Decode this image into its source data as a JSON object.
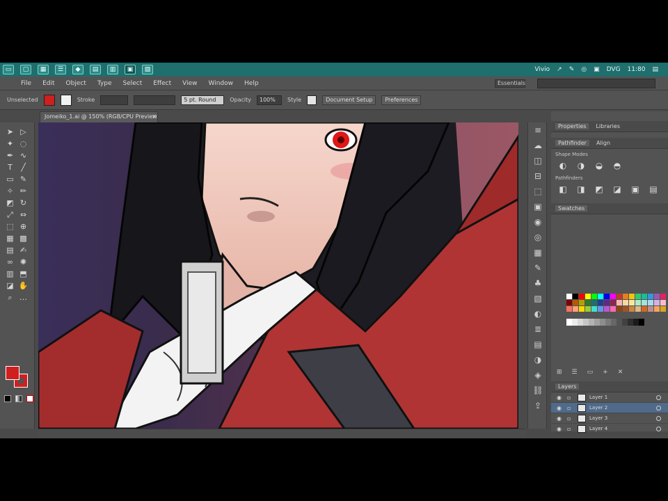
{
  "taskbar": {
    "icons": [
      "window-icon",
      "desktop-icon",
      "file-explorer-icon",
      "list-icon",
      "diamond-app-icon",
      "spreadsheet-icon",
      "chart-app-icon",
      "illustrator-icon",
      "image-app-icon"
    ],
    "tray": {
      "label_1": "Vivio",
      "label_2": "DVG",
      "clock": "11:80"
    }
  },
  "menubar": {
    "items": [
      "File",
      "Edit",
      "Object",
      "Type",
      "Select",
      "Effect",
      "View",
      "Window",
      "Help"
    ],
    "workspace": "Essentials"
  },
  "control_bar": {
    "label": "Unselected",
    "stroke_label": "Stroke",
    "brush_value": "5 pt. Round",
    "opacity_label": "Opacity",
    "opacity_value": "100%",
    "style_label": "Style",
    "doc_setup_button": "Document Setup",
    "preferences_button": "Preferences"
  },
  "document_tab": {
    "title": "Jomeiko_1.ai @ 150% (RGB/CPU Preview)",
    "close": "×"
  },
  "panels": {
    "transform_tabs": [
      "Properties",
      "Libraries"
    ],
    "align_tabs": [
      "Pathfinder",
      "Align"
    ],
    "shape_modes_label": "Shape Modes",
    "pathfinders_label": "Pathfinders",
    "swatches_tab": "Swatches",
    "layers_tab": "Layers",
    "layers": [
      {
        "name": "Layer 1",
        "selected": false
      },
      {
        "name": "Layer 2",
        "selected": true
      },
      {
        "name": "Layer 3",
        "selected": false
      },
      {
        "name": "Layer 4",
        "selected": false
      }
    ]
  },
  "colors": {
    "accent_taskbar": "#1e6f6d",
    "ui_gray": "#535353",
    "fill": "#cf1f1f",
    "selection_blue": "#4f6a8a"
  },
  "swatches": [
    "#ffffff",
    "#000000",
    "#ff0000",
    "#ffff00",
    "#00ff00",
    "#00ffff",
    "#0000ff",
    "#ff00ff",
    "#c0392b",
    "#e67e22",
    "#f1c40f",
    "#2ecc71",
    "#1abc9c",
    "#3498db",
    "#9b59b6",
    "#e91e63",
    "#7f0000",
    "#b35900",
    "#b3a100",
    "#2f7a2f",
    "#1f6f6f",
    "#1f3f8f",
    "#5b2a86",
    "#8e2550",
    "#f5b7b1",
    "#fad7a0",
    "#f9e79f",
    "#abebc6",
    "#a3e4d7",
    "#aed6f1",
    "#d2b4de",
    "#f8bbd0",
    "#ff6f61",
    "#ffa07a",
    "#ffd700",
    "#9acd32",
    "#40e0d0",
    "#6495ed",
    "#ba55d3",
    "#ff69b4",
    "#8b4513",
    "#a0522d",
    "#cd853f",
    "#deb887",
    "#d2691e",
    "#bc8f8f",
    "#f4a460",
    "#daa520"
  ],
  "gray_ramp": [
    "#ffffff",
    "#ececec",
    "#d9d9d9",
    "#c6c6c6",
    "#b3b3b3",
    "#a0a0a0",
    "#8d8d8d",
    "#7a7a7a",
    "#676767",
    "#545454",
    "#414141",
    "#2e2e2e",
    "#1b1b1b",
    "#000000"
  ]
}
